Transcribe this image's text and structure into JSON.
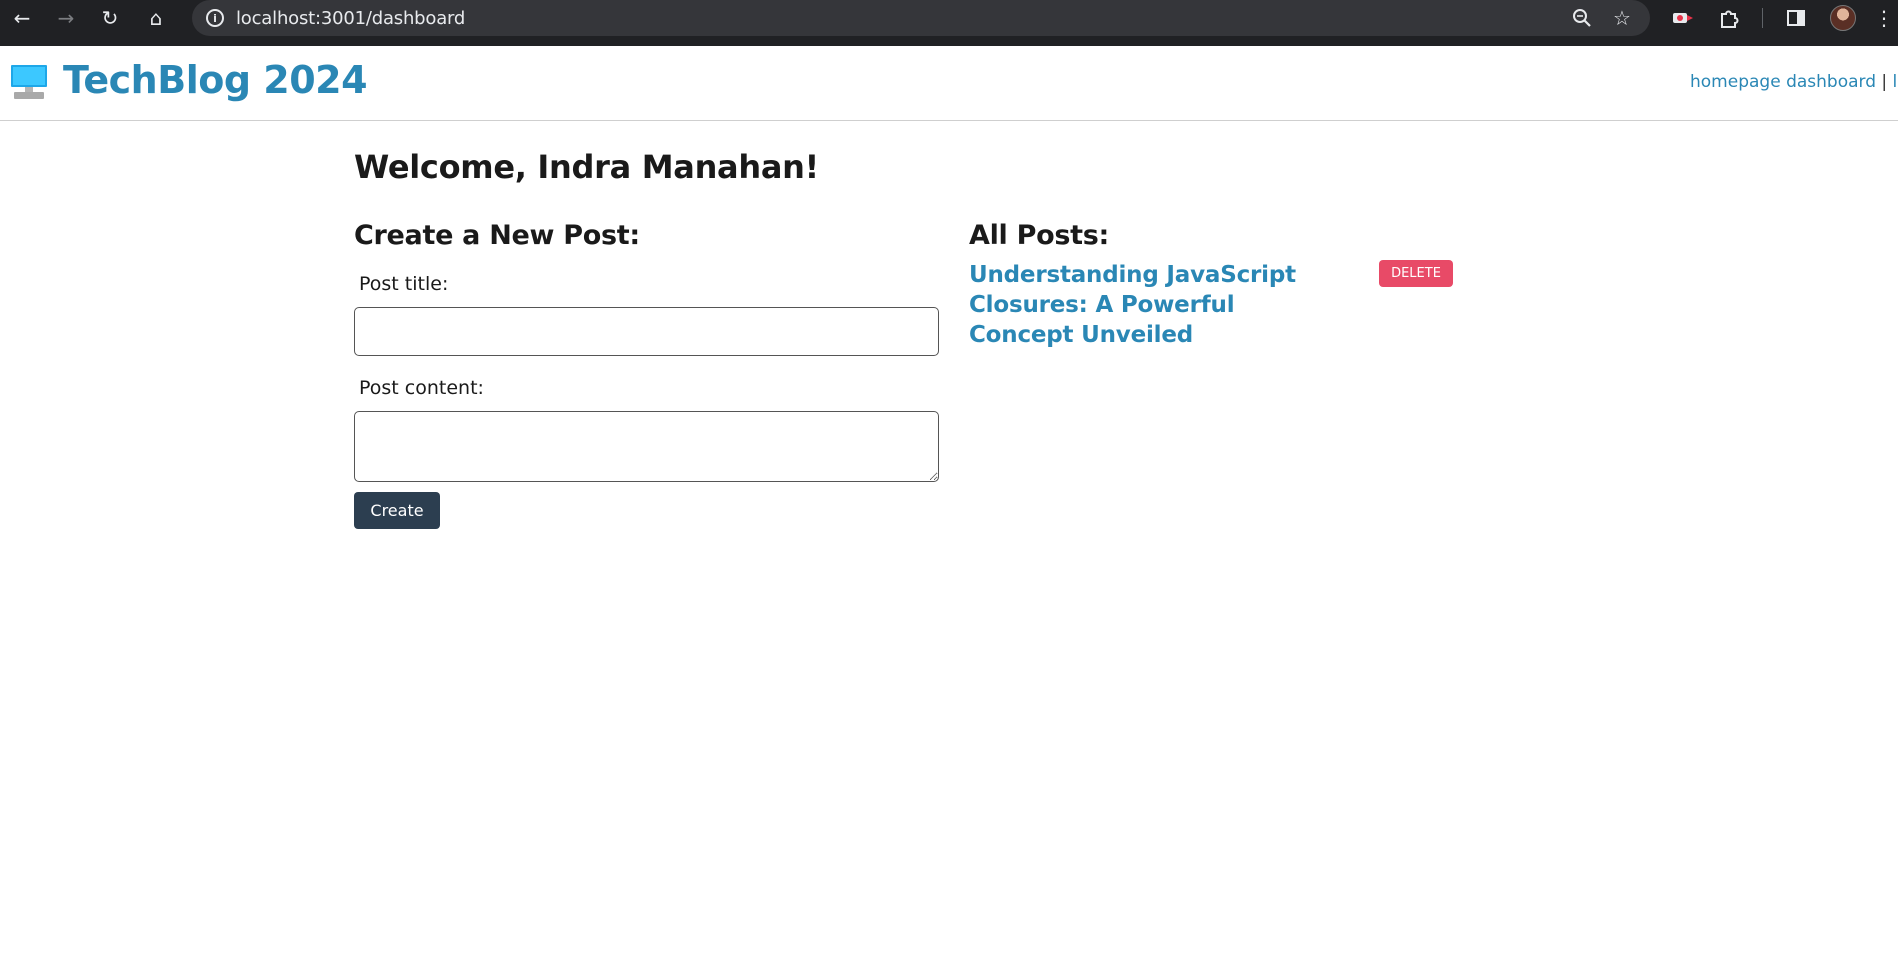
{
  "browser": {
    "url": "localhost:3001/dashboard",
    "icons": [
      "back-icon",
      "forward-icon",
      "reload-icon",
      "home-icon",
      "site-info-icon",
      "zoom-icon",
      "bookmark-star-icon",
      "extension-icon",
      "puzzle-icon",
      "side-panel-icon",
      "profile-avatar",
      "menu-icon"
    ]
  },
  "header": {
    "site_title": "TechBlog 2024",
    "logo_icon": "computer-monitor-icon",
    "nav": {
      "homepage": "homepage",
      "dashboard": "dashboard",
      "separator": "|",
      "logout": "logou"
    }
  },
  "main": {
    "welcome": "Welcome, Indra Manahan!",
    "create_section": {
      "title": "Create a New Post:",
      "post_title_label": "Post title:",
      "post_title_value": "",
      "post_content_label": "Post content:",
      "post_content_value": "",
      "create_button": "Create"
    },
    "posts_section": {
      "title": "All Posts:",
      "posts": [
        {
          "title": "Understanding JavaScript Closures: A Powerful Concept Unveiled",
          "delete_label": "DELETE"
        }
      ]
    }
  },
  "colors": {
    "link_blue": "#2a87b5",
    "create_button_bg": "#2c3e50",
    "delete_button_bg": "#e84a67",
    "chrome_bg": "#202124"
  }
}
